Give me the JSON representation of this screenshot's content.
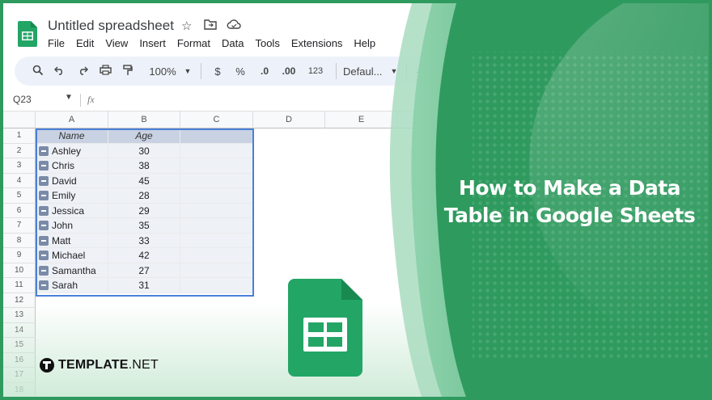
{
  "app": {
    "title": "Untitled spreadsheet",
    "menu": [
      "File",
      "Edit",
      "View",
      "Insert",
      "Format",
      "Data",
      "Tools",
      "Extensions",
      "Help"
    ],
    "toolbar": {
      "zoom": "100%",
      "currency": "$",
      "percent": "%",
      "dec_decrease": ".0",
      "dec_increase": ".00",
      "number_format": "123",
      "font": "Defaul...",
      "minus": "—"
    },
    "name_box": "Q23",
    "fx": "fx",
    "columns": [
      "A",
      "B",
      "C",
      "D",
      "E"
    ],
    "rows": [
      "1",
      "2",
      "3",
      "4",
      "5",
      "6",
      "7",
      "8",
      "9",
      "10",
      "11",
      "12",
      "13",
      "14",
      "15",
      "16",
      "17",
      "18"
    ],
    "table": {
      "headers": [
        "Name",
        "Age"
      ],
      "data": [
        [
          "Ashley",
          "30"
        ],
        [
          "Chris",
          "38"
        ],
        [
          "David",
          "45"
        ],
        [
          "Emily",
          "28"
        ],
        [
          "Jessica",
          "29"
        ],
        [
          "John",
          "35"
        ],
        [
          "Matt",
          "33"
        ],
        [
          "Michael",
          "42"
        ],
        [
          "Samantha",
          "27"
        ],
        [
          "Sarah",
          "31"
        ]
      ]
    }
  },
  "hero": {
    "line1": "How to Make a Data",
    "line2": "Table in Google Sheets"
  },
  "brand": {
    "bold": "TEMPLATE",
    "light": ".NET"
  },
  "colors": {
    "brand_green": "#2f9a5e",
    "sheets_green": "#23a566",
    "table_header": "#c9d2e3",
    "selection_blue": "#4a80d9"
  }
}
